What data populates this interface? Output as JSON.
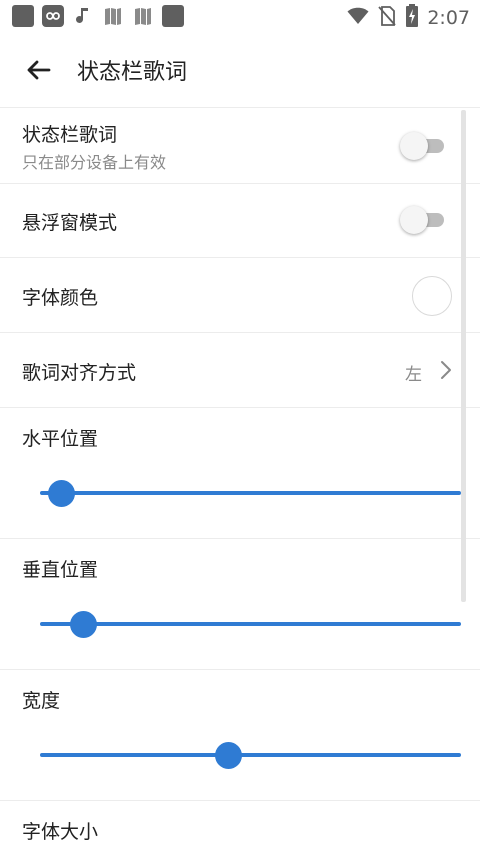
{
  "status_bar": {
    "time": "2:07",
    "icons": [
      "app-square-icon",
      "infinity-app-icon",
      "music-note-icon",
      "book-icon",
      "book-icon",
      "app-square-icon",
      "wifi-icon",
      "no-sim-icon",
      "battery-charging-icon"
    ]
  },
  "appbar": {
    "title": "状态栏歌词"
  },
  "settings": {
    "statusbar_lyrics": {
      "title": "状态栏歌词",
      "subtitle": "只在部分设备上有效",
      "enabled": false
    },
    "floating_mode": {
      "title": "悬浮窗模式",
      "enabled": false
    },
    "font_color": {
      "title": "字体颜色",
      "color": "#ffffff"
    },
    "alignment": {
      "title": "歌词对齐方式",
      "value": "左"
    },
    "horizontal_position": {
      "title": "水平位置",
      "level": 0.05
    },
    "vertical_position": {
      "title": "垂直位置",
      "level": 0.103
    },
    "width": {
      "title": "宽度",
      "level": 0.447
    },
    "font_size": {
      "title": "字体大小"
    }
  },
  "colors": {
    "accent": "#2f7bd3",
    "divider": "#ececec",
    "secondary_text": "#8a8a8a"
  }
}
